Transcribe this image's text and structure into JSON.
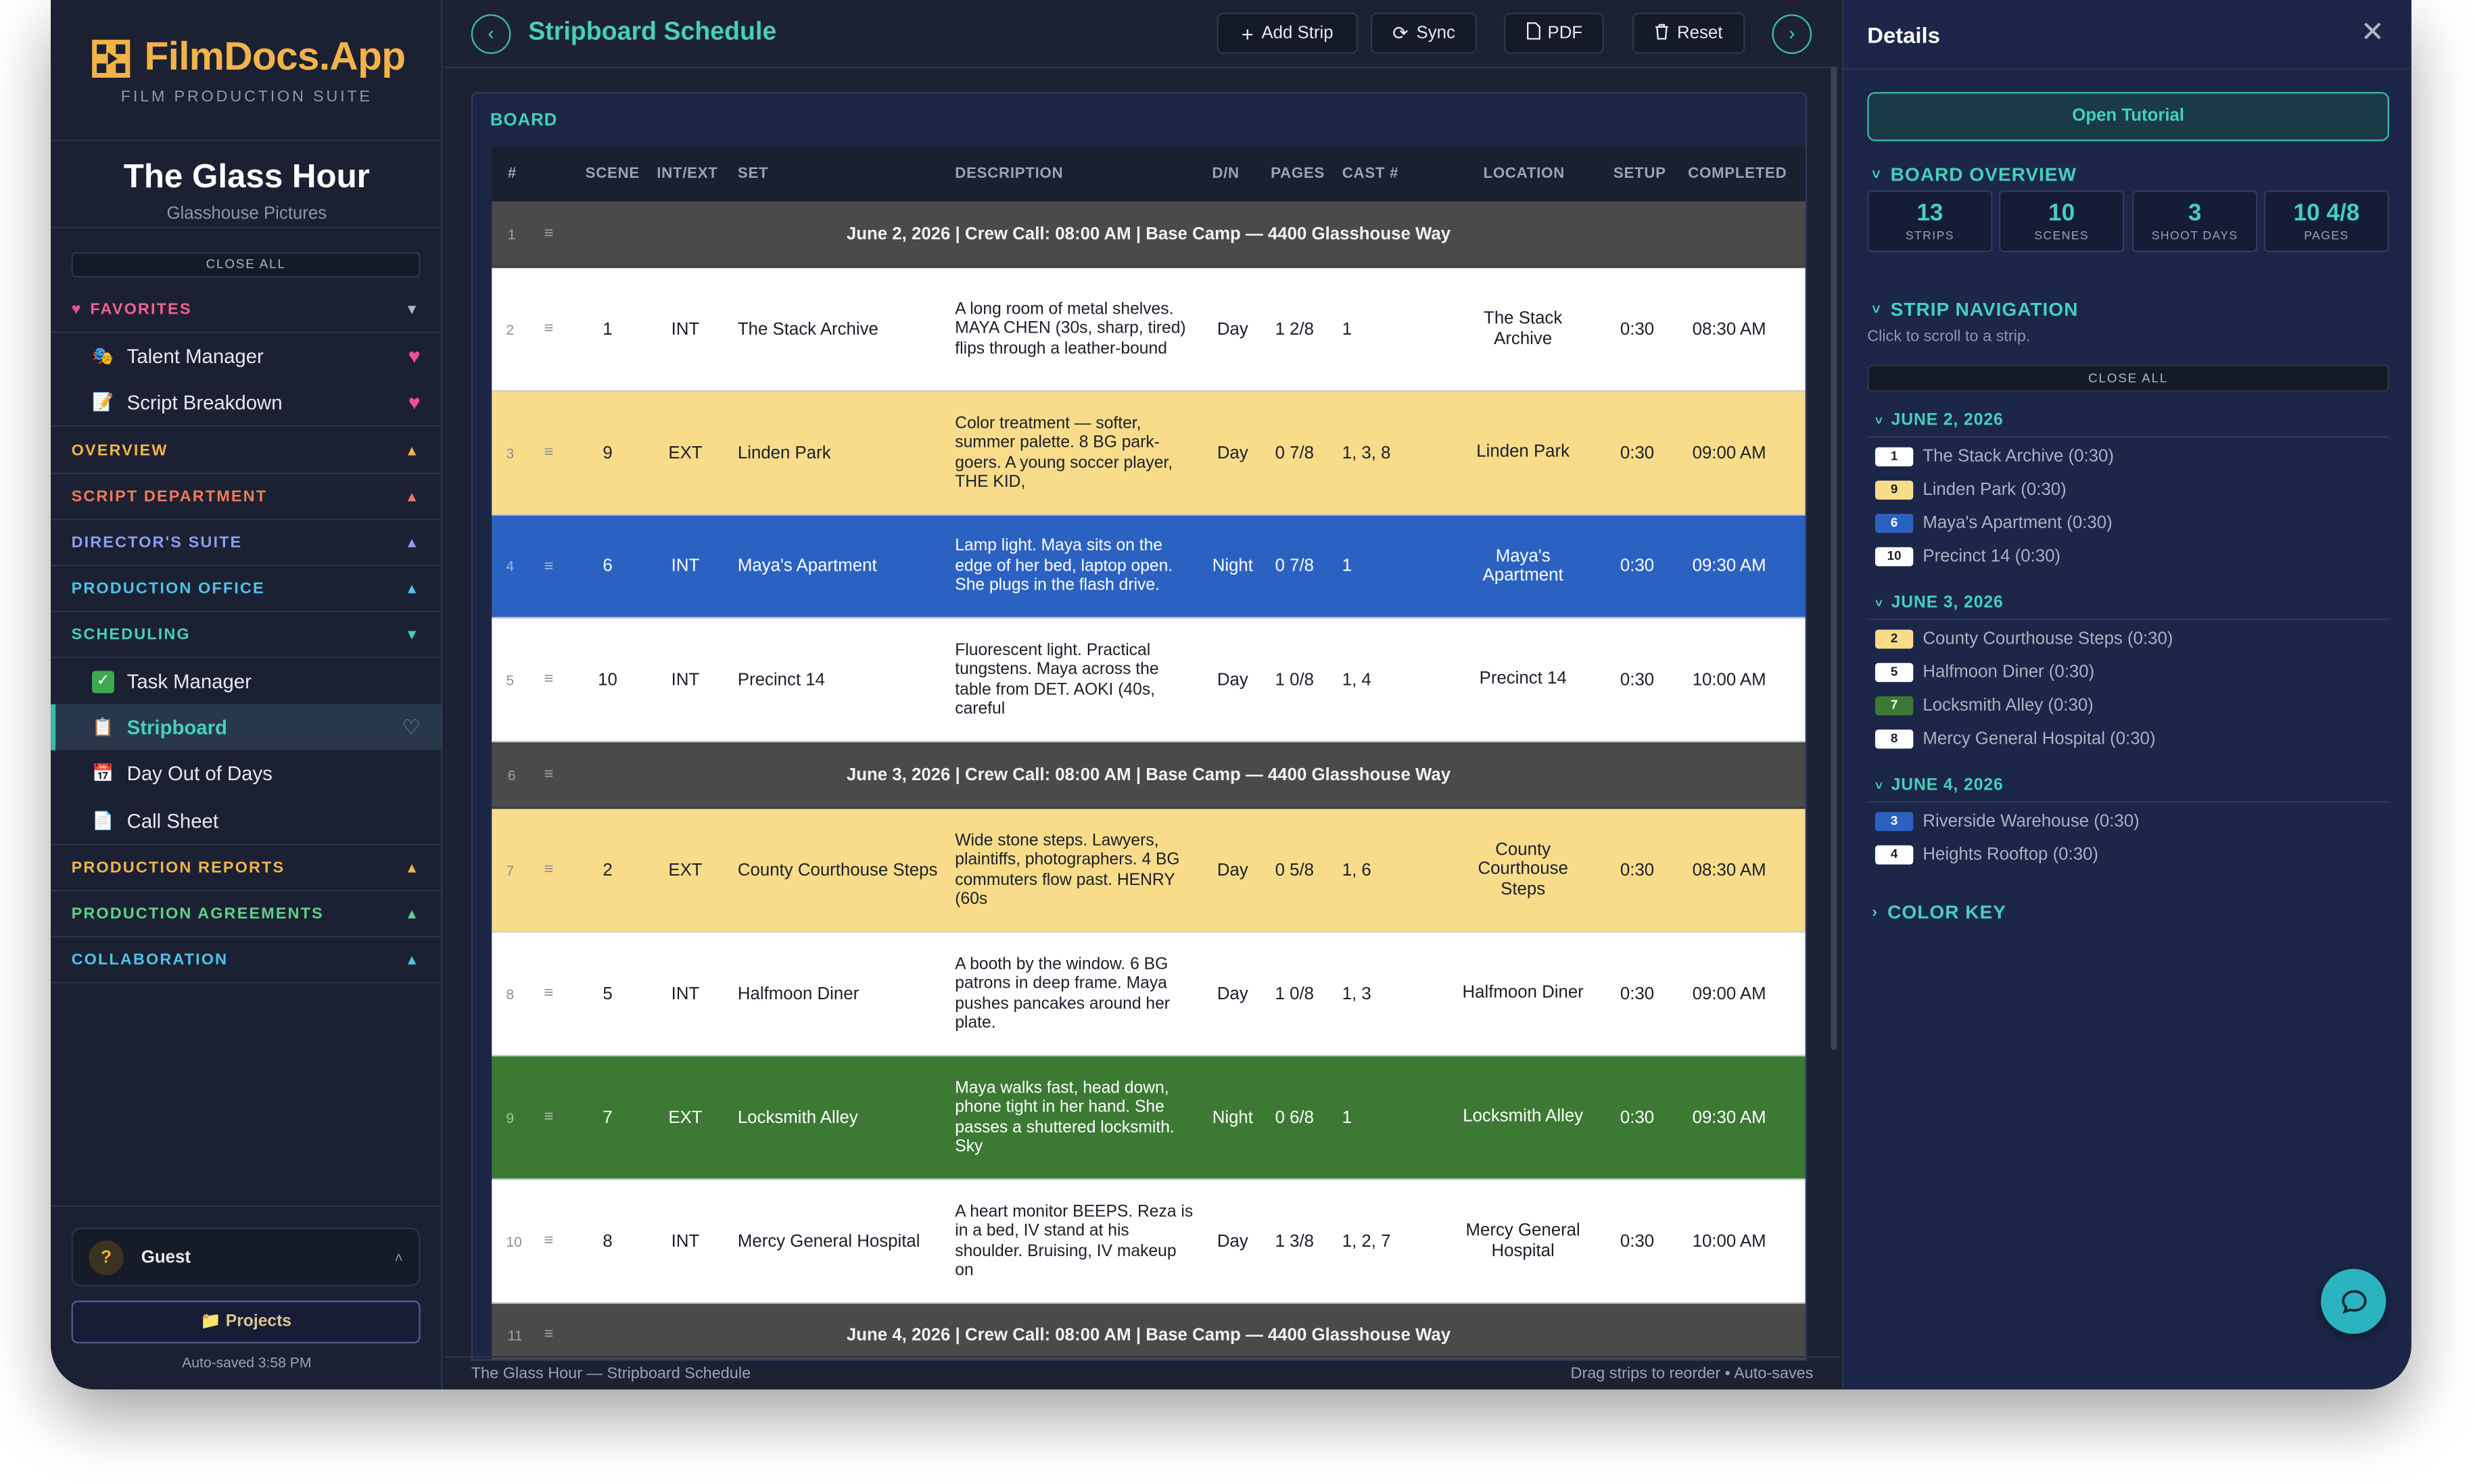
{
  "app": {
    "name": "FilmDocs.App",
    "subtitle": "FILM PRODUCTION SUITE"
  },
  "project": {
    "title": "The Glass Hour",
    "company": "Glasshouse Pictures"
  },
  "sidebar": {
    "close_all": "CLOSE ALL",
    "favorites": {
      "label": "FAVORITES",
      "items": [
        {
          "label": "Talent Manager",
          "icon": "theater-masks-icon"
        },
        {
          "label": "Script Breakdown",
          "icon": "memo-icon"
        }
      ]
    },
    "sections": [
      {
        "label": "OVERVIEW",
        "color": "#f2b34a"
      },
      {
        "label": "SCRIPT DEPARTMENT",
        "color": "#f07a5a"
      },
      {
        "label": "DIRECTOR'S SUITE",
        "color": "#8e9cf2"
      },
      {
        "label": "PRODUCTION OFFICE",
        "color": "#4ec3e8"
      },
      {
        "label": "SCHEDULING",
        "color": "#45d0bc"
      }
    ],
    "scheduling_items": [
      {
        "label": "Task Manager",
        "icon": "check-box-icon"
      },
      {
        "label": "Stripboard",
        "icon": "clipboard-icon"
      },
      {
        "label": "Day Out of Days",
        "icon": "calendar-icon"
      },
      {
        "label": "Call Sheet",
        "icon": "document-icon"
      }
    ],
    "bottom_sections": [
      {
        "label": "PRODUCTION REPORTS",
        "color": "#f2b34a"
      },
      {
        "label": "PRODUCTION AGREEMENTS",
        "color": "#5fd08a"
      },
      {
        "label": "COLLABORATION",
        "color": "#4ec3e8"
      }
    ],
    "user": {
      "initial": "?",
      "name": "Guest"
    },
    "projects_button": "Projects",
    "autosaved": "Auto-saved 3:58 PM"
  },
  "toolbar": {
    "title": "Stripboard Schedule",
    "add_strip": "Add Strip",
    "sync": "Sync",
    "pdf": "PDF",
    "reset": "Reset"
  },
  "board": {
    "label": "BOARD",
    "columns": [
      "#",
      "SCENE",
      "INT/EXT",
      "SET",
      "DESCRIPTION",
      "D/N",
      "PAGES",
      "CAST #",
      "LOCATION",
      "SETUP",
      "COMPLETED"
    ],
    "rows": [
      {
        "kind": "day",
        "num": "1",
        "text": "June 2, 2026 | Crew Call: 08:00 AM | Base Camp — 4400 Glasshouse Way"
      },
      {
        "kind": "strip",
        "num": "2",
        "scene": "1",
        "ie": "INT",
        "set": "The Stack Archive",
        "desc": "A long room of metal shelves. MAYA CHEN (30s, sharp, tired) flips through a leather-bound",
        "dn": "Day",
        "pages": "1 2/8",
        "cast": "1",
        "loc": "The Stack Archive",
        "setup": "0:30",
        "done": "08:30 AM",
        "bg": "#ffffff",
        "fg": "#1b1f2a"
      },
      {
        "kind": "strip",
        "num": "3",
        "scene": "9",
        "ie": "EXT",
        "set": "Linden Park",
        "desc": "Color treatment — softer, summer palette. 8 BG park-goers. A young soccer player, THE KID,",
        "dn": "Day",
        "pages": "0 7/8",
        "cast": "1, 3, 8",
        "loc": "Linden Park",
        "setup": "0:30",
        "done": "09:00 AM",
        "bg": "#f8dc8a",
        "fg": "#1b1f2a"
      },
      {
        "kind": "strip",
        "num": "4",
        "scene": "6",
        "ie": "INT",
        "set": "Maya's Apartment",
        "desc": "Lamp light. Maya sits on the edge of her bed, laptop open. She plugs in the flash drive.",
        "dn": "Night",
        "pages": "0 7/8",
        "cast": "1",
        "loc": "Maya's Apartment",
        "setup": "0:30",
        "done": "09:30 AM",
        "bg": "#2b62c2",
        "fg": "#ffffff"
      },
      {
        "kind": "strip",
        "num": "5",
        "scene": "10",
        "ie": "INT",
        "set": "Precinct 14",
        "desc": "Fluorescent light. Practical tungstens. Maya across the table from DET. AOKI (40s, careful",
        "dn": "Day",
        "pages": "1 0/8",
        "cast": "1, 4",
        "loc": "Precinct 14",
        "setup": "0:30",
        "done": "10:00 AM",
        "bg": "#ffffff",
        "fg": "#1b1f2a"
      },
      {
        "kind": "day",
        "num": "6",
        "text": "June 3, 2026 | Crew Call: 08:00 AM | Base Camp — 4400 Glasshouse Way"
      },
      {
        "kind": "strip",
        "num": "7",
        "scene": "2",
        "ie": "EXT",
        "set": "County Courthouse Steps",
        "desc": "Wide stone steps. Lawyers, plaintiffs, photographers. 4 BG commuters flow past. HENRY (60s",
        "dn": "Day",
        "pages": "0 5/8",
        "cast": "1, 6",
        "loc": "County Courthouse Steps",
        "setup": "0:30",
        "done": "08:30 AM",
        "bg": "#f8dc8a",
        "fg": "#1b1f2a"
      },
      {
        "kind": "strip",
        "num": "8",
        "scene": "5",
        "ie": "INT",
        "set": "Halfmoon Diner",
        "desc": "A booth by the window. 6 BG patrons in deep frame. Maya pushes pancakes around her plate.",
        "dn": "Day",
        "pages": "1 0/8",
        "cast": "1, 3",
        "loc": "Halfmoon Diner",
        "setup": "0:30",
        "done": "09:00 AM",
        "bg": "#ffffff",
        "fg": "#1b1f2a"
      },
      {
        "kind": "strip",
        "num": "9",
        "scene": "7",
        "ie": "EXT",
        "set": "Locksmith Alley",
        "desc": "Maya walks fast, head down, phone tight in her hand. She passes a shuttered locksmith. Sky",
        "dn": "Night",
        "pages": "0 6/8",
        "cast": "1",
        "loc": "Locksmith Alley",
        "setup": "0:30",
        "done": "09:30 AM",
        "bg": "#3c7a34",
        "fg": "#ffffff"
      },
      {
        "kind": "strip",
        "num": "10",
        "scene": "8",
        "ie": "INT",
        "set": "Mercy General Hospital",
        "desc": "A heart monitor BEEPS. Reza is in a bed, IV stand at his shoulder. Bruising, IV makeup on",
        "dn": "Day",
        "pages": "1 3/8",
        "cast": "1, 2, 7",
        "loc": "Mercy General Hospital",
        "setup": "0:30",
        "done": "10:00 AM",
        "bg": "#ffffff",
        "fg": "#1b1f2a"
      },
      {
        "kind": "day",
        "num": "11",
        "text": "June 4, 2026 | Crew Call: 08:00 AM | Base Camp — 4400 Glasshouse Way"
      }
    ]
  },
  "footer": {
    "left": "The Glass Hour — Stripboard Schedule",
    "right": "Drag strips to reorder • Auto-saves"
  },
  "details": {
    "title": "Details",
    "tutorial": "Open Tutorial",
    "overview_label": "BOARD OVERVIEW",
    "stats": [
      {
        "value": "13",
        "label": "STRIPS"
      },
      {
        "value": "10",
        "label": "SCENES"
      },
      {
        "value": "3",
        "label": "SHOOT DAYS"
      },
      {
        "value": "10 4/8",
        "label": "PAGES"
      }
    ],
    "nav_label": "STRIP NAVIGATION",
    "nav_hint": "Click to scroll to a strip.",
    "close_all": "CLOSE ALL",
    "days": [
      {
        "label": "JUNE 2, 2026",
        "strips": [
          {
            "scene": "1",
            "name": "The Stack Archive (0:30)",
            "bg": "#ffffff",
            "fg": "#1b1f2a"
          },
          {
            "scene": "9",
            "name": "Linden Park (0:30)",
            "bg": "#f8dc8a",
            "fg": "#1b1f2a"
          },
          {
            "scene": "6",
            "name": "Maya's Apartment (0:30)",
            "bg": "#2b62c2",
            "fg": "#ffffff"
          },
          {
            "scene": "10",
            "name": "Precinct 14 (0:30)",
            "bg": "#ffffff",
            "fg": "#1b1f2a"
          }
        ]
      },
      {
        "label": "JUNE 3, 2026",
        "strips": [
          {
            "scene": "2",
            "name": "County Courthouse Steps (0:30)",
            "bg": "#f8dc8a",
            "fg": "#1b1f2a"
          },
          {
            "scene": "5",
            "name": "Halfmoon Diner (0:30)",
            "bg": "#ffffff",
            "fg": "#1b1f2a"
          },
          {
            "scene": "7",
            "name": "Locksmith Alley (0:30)",
            "bg": "#3c7a34",
            "fg": "#ffffff"
          },
          {
            "scene": "8",
            "name": "Mercy General Hospital (0:30)",
            "bg": "#ffffff",
            "fg": "#1b1f2a"
          }
        ]
      },
      {
        "label": "JUNE 4, 2026",
        "strips": [
          {
            "scene": "3",
            "name": "Riverside Warehouse (0:30)",
            "bg": "#2b62c2",
            "fg": "#ffffff"
          },
          {
            "scene": "4",
            "name": "Heights Rooftop (0:30)",
            "bg": "#ffffff",
            "fg": "#1b1f2a"
          }
        ]
      }
    ],
    "color_key": "COLOR KEY"
  }
}
